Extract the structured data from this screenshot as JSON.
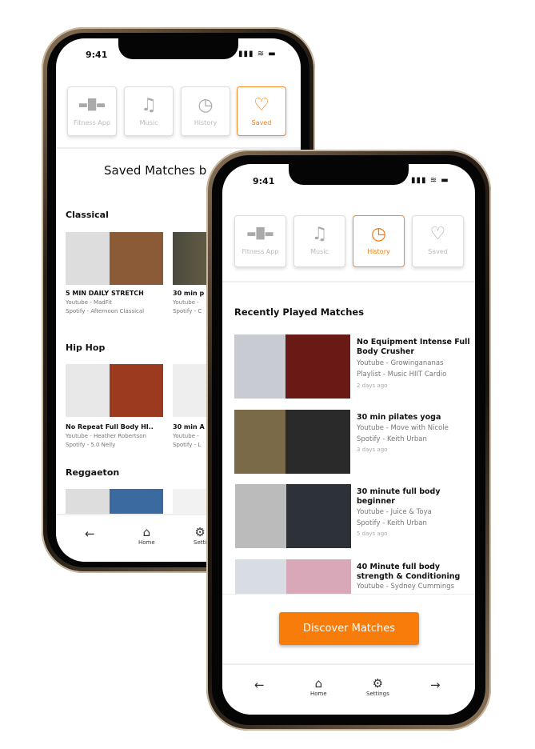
{
  "status": {
    "time": "9:41",
    "signal": "▮▮▮ ≋ ▬"
  },
  "tabs": [
    {
      "label": "Fitness App",
      "icon": "dumbbell-icon",
      "glyph": "▬█▬"
    },
    {
      "label": "Music",
      "icon": "music-note-icon",
      "glyph": "♫"
    },
    {
      "label": "History",
      "icon": "clock-icon",
      "glyph": "◷"
    },
    {
      "label": "Saved",
      "icon": "heart-icon",
      "glyph": "♡"
    }
  ],
  "accent": "#f87c0a",
  "back_phone": {
    "active_tab": "Saved",
    "title": "Saved Matches b",
    "sections": [
      {
        "name": "Classical",
        "cards": [
          {
            "title": "5 MIN DAILY STRETCH",
            "sub1": "Youtube - MadFit",
            "sub2": "Spotify - Afternoon Classical"
          },
          {
            "title": "30 min p",
            "sub1": "Youtube - ",
            "sub2": "Spotify - C"
          }
        ]
      },
      {
        "name": "Hip Hop",
        "cards": [
          {
            "title": "No Repeat Full Body HI..",
            "sub1": "Youtube - Heather Robertson",
            "sub2": "Spotify - 5.0 Nelly"
          },
          {
            "title": "30 min A",
            "sub1": "Youtube - ",
            "sub2": "Spotify - L"
          }
        ]
      },
      {
        "name": "Reggaeton",
        "cards": [
          {
            "title": "",
            "sub1": "",
            "sub2": ""
          },
          {
            "title": "",
            "sub1": "",
            "sub2": ""
          }
        ]
      }
    ],
    "nav": {
      "back": "←",
      "home": "Home",
      "settings": "Setti"
    }
  },
  "front_phone": {
    "active_tab": "History",
    "title": "Recently Played Matches",
    "rows": [
      {
        "title": "No Equipment Intense Full Body Crusher",
        "sub1": "Youtube - Growingananas",
        "sub2": "Playlist - Music HIIT Cardio",
        "date": "2 days ago"
      },
      {
        "title": "30 min pilates yoga",
        "sub1": "Youtube - Move with Nicole",
        "sub2": "Spotify - Keith Urban",
        "date": "3 days ago"
      },
      {
        "title": "30 minute full body beginner",
        "sub1": "Youtube - Juice & Toya",
        "sub2": "Spotify - Keith Urban",
        "date": "5 days ago"
      },
      {
        "title": "40 Minute full body strength & Conditioning",
        "sub1": "Youtube - Sydney Cummings",
        "sub2": "",
        "date": ""
      }
    ],
    "button": "Discover Matches",
    "nav": {
      "back": "←",
      "home": "Home",
      "settings": "Settings",
      "forward": "→",
      "home_glyph": "⌂",
      "settings_glyph": "⚙"
    }
  }
}
